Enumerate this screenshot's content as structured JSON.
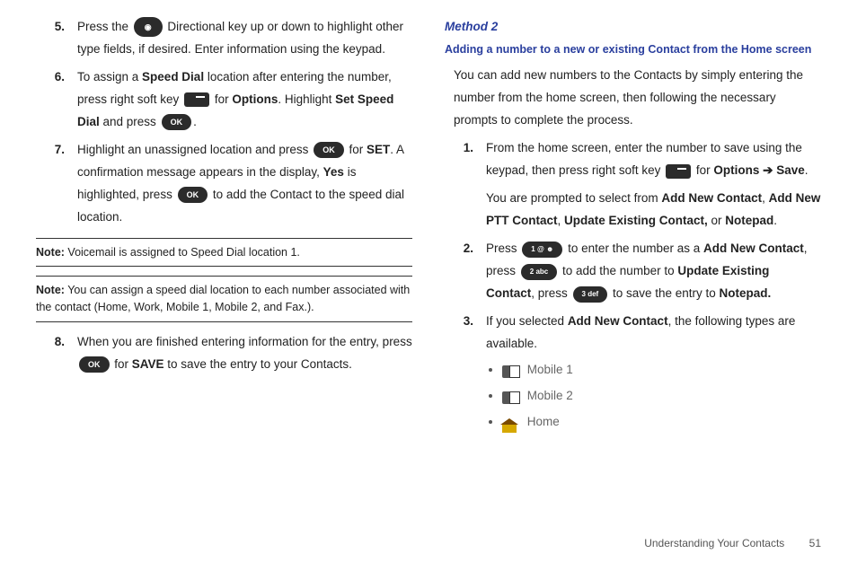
{
  "left": {
    "steps": [
      {
        "n": "5.",
        "pre": "Press the ",
        "post": " Directional key up or down to highlight other type fields, if desired. Enter information using the keypad."
      },
      {
        "n": "6.",
        "a": "To assign a ",
        "b": "Speed Dial",
        "c": " location after entering the number, press right soft key ",
        "d": " for ",
        "e": "Options",
        "f": ". Highlight ",
        "g": "Set Speed Dial",
        "h": " and press ",
        "i": "."
      },
      {
        "n": "7.",
        "a": "Highlight an unassigned location and press ",
        "b": " for ",
        "c": "SET",
        "d": ". A confirmation message appears in the display, ",
        "e": "Yes",
        "f": " is highlighted, press ",
        "g": " to add the Contact to the speed dial location."
      },
      {
        "n": "8.",
        "a": "When you are finished entering information for the entry, press ",
        "b": " for ",
        "c": "SAVE",
        "d": " to save the entry to your Contacts."
      }
    ],
    "note1_label": "Note:",
    "note1": " Voicemail is assigned to Speed Dial location 1.",
    "note2_label": "Note:",
    "note2": " You can assign a speed dial location to each number associated with the contact (Home, Work, Mobile 1, Mobile 2, and Fax.)."
  },
  "right": {
    "method": "Method 2",
    "subtitle": "Adding a number to a new or existing Contact from the Home screen",
    "intro": "You can add new numbers to the Contacts by simply entering the number from the home screen, then following the necessary prompts to complete the process.",
    "steps": [
      {
        "n": "1.",
        "a": "From the home screen, enter the number to save using the keypad, then press right soft key ",
        "b": " for ",
        "c": "Options ➔ Save",
        "d": ".",
        "p2a": "You are prompted to select from ",
        "p2b": "Add New Contact",
        "p2c": ", ",
        "p2d": "Add New PTT Contact",
        "p2e": ", ",
        "p2f": "Update Existing Contact,",
        "p2g": " or ",
        "p2h": "Notepad",
        "p2i": "."
      },
      {
        "n": "2.",
        "a": "Press ",
        "b": " to enter the number as a ",
        "c": "Add New Contact",
        "d": ", press ",
        "e": " to add the number to ",
        "f": "Update Existing Contact",
        "g": ", press ",
        "h": " to save the entry to ",
        "i": "Notepad."
      },
      {
        "n": "3.",
        "a": "If you selected ",
        "b": "Add New Contact",
        "c": ", the following types are available.",
        "items": [
          "Mobile 1",
          "Mobile 2",
          "Home"
        ]
      }
    ]
  },
  "keys": {
    "ok": "OK",
    "dpad": "◉",
    "k1": "1 @ ☻",
    "k2": "2 abc",
    "k3": "3 def"
  },
  "footer": {
    "section": "Understanding Your Contacts",
    "page": "51"
  }
}
